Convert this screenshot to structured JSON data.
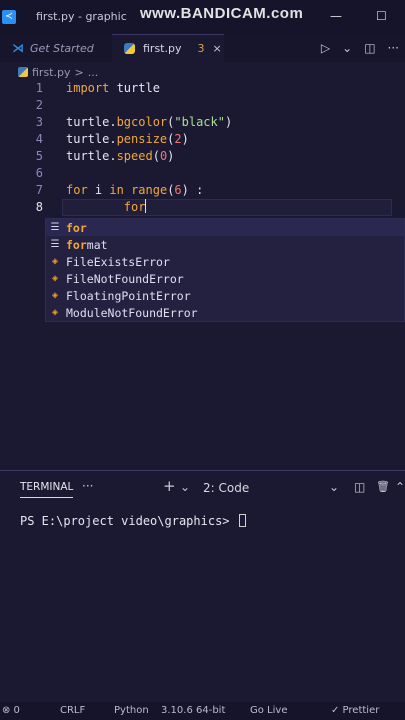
{
  "title_bar": {
    "title": "first.py - graphic",
    "watermark": "www.BANDICAM.com",
    "minimize": "—",
    "maximize": "☐"
  },
  "tabs": [
    {
      "label": "Get Started",
      "active": false
    },
    {
      "label": "first.py",
      "badge": "3",
      "close": "×",
      "active": true
    }
  ],
  "tab_actions": {
    "run": "▷",
    "chevron": "⌄",
    "split": "◫",
    "more": "···"
  },
  "breadcrumb": {
    "file": "first.py",
    "sep": ">",
    "rest": "..."
  },
  "editor": {
    "line_numbers": [
      "1",
      "2",
      "3",
      "4",
      "5",
      "6",
      "7",
      "8"
    ],
    "lines": {
      "l1_kw": "import",
      "l1_rest": " turtle",
      "l3_obj": "turtle.",
      "l3_fn": "bgcolor",
      "l3_open": "(",
      "l3_str": "\"black\"",
      "l3_close": ")",
      "l4_obj": "turtle.",
      "l4_fn": "pensize",
      "l4_open": "(",
      "l4_num": "2",
      "l4_close": ")",
      "l5_obj": "turtle.",
      "l5_fn": "speed",
      "l5_open": "(",
      "l5_num": "0",
      "l5_close": ")",
      "l7_kw1": "for",
      "l7_mid": " i ",
      "l7_kw2": "in",
      "l7_sp": " ",
      "l7_fn": "range",
      "l7_open": "(",
      "l7_num": "6",
      "l7_close": ") :",
      "l8_indent": "        ",
      "l8_text": "for"
    }
  },
  "suggestions": [
    {
      "icon": "☰",
      "match": "for",
      "rest": ""
    },
    {
      "icon": "☰",
      "match": "for",
      "rest": "mat"
    },
    {
      "icon": "◈",
      "pre": "",
      "text": "FileExistsError"
    },
    {
      "icon": "◈",
      "text": "FileNotFoundError"
    },
    {
      "icon": "◈",
      "text": "FloatingPointError"
    },
    {
      "icon": "◈",
      "text": "ModuleNotFoundError"
    }
  ],
  "panel": {
    "tab": "TERMINAL",
    "more": "···",
    "add": "+",
    "add_chevron": "⌄",
    "terminal_select": "2: Code",
    "chevron": "⌄",
    "split": "◫",
    "trash": "🗑",
    "collapse": "⌃",
    "close": "×",
    "prompt": "PS E:\\project video\\graphics> "
  },
  "status_bar": {
    "problems": "⊗ 0",
    "warnings": "⚠ 0",
    "eol": "CRLF",
    "language": "Python",
    "interpreter": "3.10.6 64-bit",
    "live": "Go Live",
    "prettier": "✓ Prettier",
    "feedback": "☺",
    "bell": "🔔"
  }
}
